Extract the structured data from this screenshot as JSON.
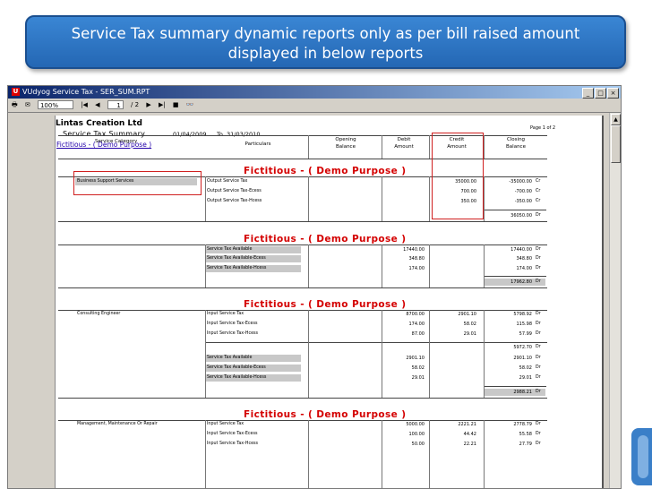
{
  "banner": {
    "line1": "Service Tax summary dynamic reports only as per bill raised amount",
    "line2": "displayed in below reports"
  },
  "window": {
    "title": "VUdyog Service Tax - SER_SUM.RPT",
    "toolbar": {
      "zoom": "100%",
      "page": "1",
      "page_total": "/ 2"
    }
  },
  "report": {
    "company": "Lintas Creation Ltd",
    "title": "Service Tax Summary",
    "from": "01/04/2009",
    "to_label": "To",
    "to": "31/03/2010",
    "page_of": "Page 1 of 2",
    "fictitious_header": "Fictitious - ( Demo Purpose )",
    "service_category_label": "Service Category",
    "columns": {
      "particulars": "Particulars",
      "opening": "Opening",
      "balance": "Balance",
      "debit": "Debit",
      "credit": "Credit",
      "amount": "Amount",
      "closing": "Closing",
      "closing_balance": "Balance"
    },
    "sections": [
      {
        "banner": "Fictitious - ( Demo Purpose )",
        "category": "Business Support Services",
        "rows": [
          {
            "particular": "Output Service Tax",
            "credit": "35000.00",
            "closing": "-35000.00",
            "drcr": "Cr"
          },
          {
            "particular": "Output Service Tax-Ecess",
            "credit": "700.00",
            "closing": "-700.00",
            "drcr": "Cr"
          },
          {
            "particular": "Output Service Tax-Hcess",
            "credit": "350.00",
            "closing": "-350.00",
            "drcr": "Cr"
          }
        ],
        "total": "36050.00",
        "total_drcr": "Dr"
      },
      {
        "banner": "Fictitious - ( Demo Purpose )",
        "rows": [
          {
            "particular": "Service Tax Available",
            "debit": "17440.00",
            "closing": "17440.00",
            "drcr": "Dr"
          },
          {
            "particular": "Service Tax Available-Ecess",
            "debit": "348.80",
            "closing": "348.80",
            "drcr": "Dr"
          },
          {
            "particular": "Service Tax Available-Hcess",
            "debit": "174.00",
            "closing": "174.00",
            "drcr": "Dr"
          }
        ],
        "total": "17962.80",
        "total_drcr": "Dr"
      },
      {
        "banner": "Fictitious - ( Demo Purpose )",
        "category": "Consulting Engineer",
        "rows": [
          {
            "particular": "Input Service Tax",
            "debit": "8700.00",
            "credit": "2901.10",
            "closing": "5798.92",
            "drcr": "Dr"
          },
          {
            "particular": "Input Service Tax-Ecess",
            "debit": "174.00",
            "credit": "58.02",
            "closing": "115.98",
            "drcr": "Dr"
          },
          {
            "particular": "Input Service Tax-Hcess",
            "debit": "87.00",
            "credit": "29.01",
            "closing": "57.99",
            "drcr": "Dr"
          }
        ],
        "subtotal": "5972.70",
        "subtotal_drcr": "Dr",
        "rows2": [
          {
            "particular": "Service Tax Available",
            "debit": "2901.10",
            "closing": "2901.10",
            "drcr": "Dr"
          },
          {
            "particular": "Service Tax Available-Ecess",
            "debit": "58.02",
            "closing": "58.02",
            "drcr": "Dr"
          },
          {
            "particular": "Service Tax Available-Hcess",
            "debit": "29.01",
            "closing": "29.01",
            "drcr": "Dr"
          }
        ],
        "total": "2988.21",
        "total_drcr": "Dr"
      },
      {
        "banner": "Fictitious - ( Demo Purpose )",
        "category": "Management, Maintenance Or Repair",
        "rows": [
          {
            "particular": "Input Service Tax",
            "debit": "5000.00",
            "credit": "2221.21",
            "closing": "2778.79",
            "drcr": "Dr"
          },
          {
            "particular": "Input Service Tax-Ecess",
            "debit": "100.00",
            "credit": "44.42",
            "closing": "55.58",
            "drcr": "Dr"
          },
          {
            "particular": "Input Service Tax-Hcess",
            "debit": "50.00",
            "credit": "22.21",
            "closing": "27.79",
            "drcr": "Dr"
          }
        ]
      }
    ]
  }
}
